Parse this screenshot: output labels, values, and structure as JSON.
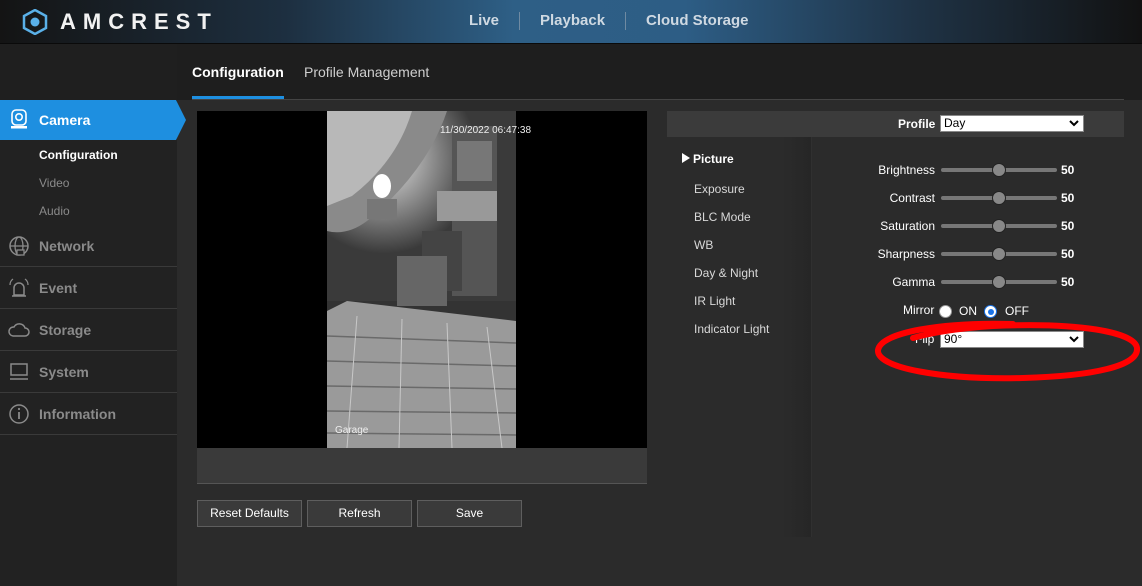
{
  "brand": {
    "name": "AMCREST"
  },
  "topnav": [
    "Live",
    "Playback",
    "Cloud Storage"
  ],
  "tabs": {
    "active": "Configuration",
    "other": "Profile Management"
  },
  "sidebar": {
    "camera": {
      "label": "Camera",
      "sub": [
        {
          "label": "Configuration",
          "active": true
        },
        {
          "label": "Video",
          "active": false
        },
        {
          "label": "Audio",
          "active": false
        }
      ]
    },
    "items": [
      {
        "label": "Network",
        "icon": "network-globe-icon"
      },
      {
        "label": "Event",
        "icon": "event-alarm-icon"
      },
      {
        "label": "Storage",
        "icon": "storage-cloud-icon"
      },
      {
        "label": "System",
        "icon": "system-monitor-icon"
      },
      {
        "label": "Information",
        "icon": "information-icon"
      }
    ]
  },
  "video": {
    "timestamp": "11/30/2022 06:47:38",
    "channel_name": "Garage"
  },
  "buttons": {
    "reset": "Reset Defaults",
    "refresh": "Refresh",
    "save": "Save"
  },
  "profile": {
    "label": "Profile",
    "value": "Day"
  },
  "settings_menu": {
    "active": "Picture",
    "items": [
      "Exposure",
      "BLC Mode",
      "WB",
      "Day & Night",
      "IR Light",
      "Indicator Light"
    ]
  },
  "picture": {
    "sliders": [
      {
        "label": "Brightness",
        "value": "50",
        "fraction": 0.5
      },
      {
        "label": "Contrast",
        "value": "50",
        "fraction": 0.5
      },
      {
        "label": "Saturation",
        "value": "50",
        "fraction": 0.5
      },
      {
        "label": "Sharpness",
        "value": "50",
        "fraction": 0.5
      },
      {
        "label": "Gamma",
        "value": "50",
        "fraction": 0.5
      }
    ],
    "mirror": {
      "label": "Mirror",
      "on_label": "ON",
      "off_label": "OFF",
      "selected": "OFF"
    },
    "flip": {
      "label": "Flip",
      "value": "90°"
    }
  },
  "colors": {
    "accent": "#1e8fe0",
    "annotation": "#ff0000"
  }
}
